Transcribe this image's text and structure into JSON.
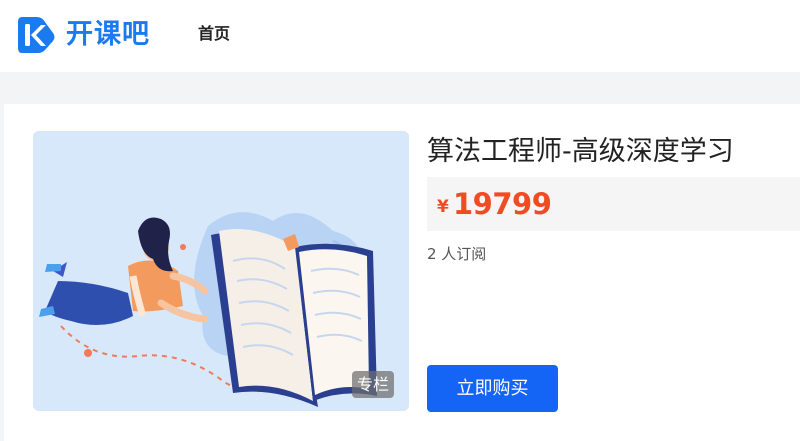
{
  "header": {
    "brand_name": "开课吧",
    "logo_icon": "k-logo-icon",
    "nav_home": "首页",
    "brand_color": "#1b7af0"
  },
  "course": {
    "badge": "专栏",
    "title": "算法工程师-高级深度学习",
    "currency_symbol": "¥",
    "price": "19799",
    "price_color": "#f04b22",
    "subscribers": "2 人订阅",
    "buy_label": "立即购买",
    "button_color": "#1465f5",
    "cover_illustration": "woman-reading-book-illustration"
  }
}
